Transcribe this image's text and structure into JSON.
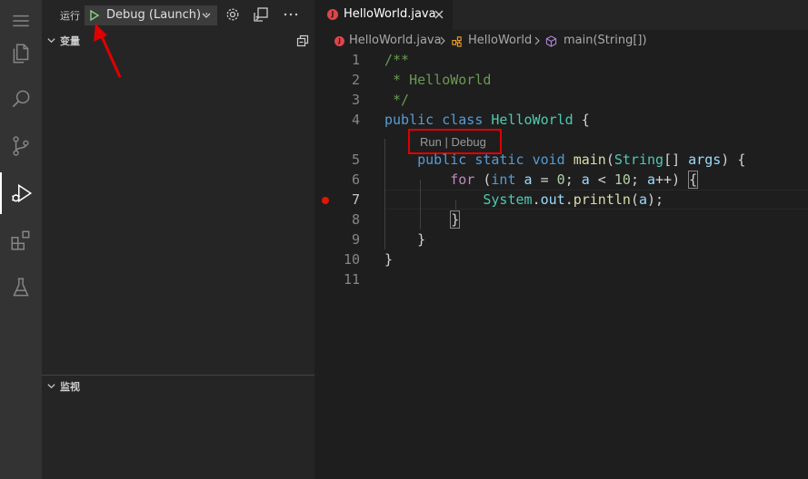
{
  "sidebar": {
    "run_label": "运行",
    "config_name": "Debug (Launch)",
    "config_suffix": "·",
    "sections": {
      "variables": "变量",
      "watch": "监视"
    }
  },
  "editor": {
    "tab_label": "HelloWorld.java",
    "file_badge": "J",
    "breadcrumb": [
      "HelloWorld.java",
      "HelloWorld",
      "main(String[])"
    ],
    "line_numbers": [
      "1",
      "2",
      "3",
      "4",
      "5",
      "6",
      "7",
      "8",
      "9",
      "10",
      "11"
    ],
    "codelens": {
      "run": "Run",
      "sep": "|",
      "debug": "Debug"
    },
    "current_line": 7
  },
  "colors": {
    "activity_bar": "#333333",
    "sidebar": "#252526",
    "editor": "#1e1e1e",
    "annotation_red": "#e00000",
    "breakpoint": "#e51400"
  }
}
